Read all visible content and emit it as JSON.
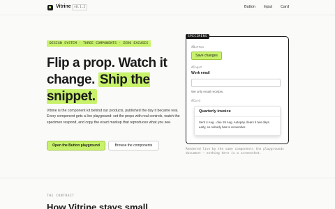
{
  "header": {
    "brand": "Vitrine",
    "version": "v0.1.2",
    "nav": [
      "Button",
      "Input",
      "Card"
    ]
  },
  "hero": {
    "tagline": "DESIGN SYSTEM · THREE COMPONENTS · ZERO EXCUSES",
    "headline_plain": "Flip a prop. Watch it change.",
    "headline_highlight": "Ship the snippet.",
    "description": "Vitrine is the component kit behind our products, published the day it became real. Every component gets a live playground: set the props with real controls, watch the specimen respond, and copy the exact markup that reproduces what you see.",
    "primary_cta": "Open the Button playground",
    "secondary_cta": "Browse the components"
  },
  "specimens": {
    "tag": "SPECIMENS",
    "button": {
      "label": "#Button",
      "text": "Save changes"
    },
    "input": {
      "label": "#Input",
      "field_label": "Work email",
      "hint": "We only email receipts."
    },
    "card": {
      "label": "#Card",
      "title": "Quarterly invoice",
      "body": "Sent 4 Aug · due 18 Aug. Autopay clears it two days early, so nobody has to remember."
    },
    "caption": "Rendered live by the same components the playgrounds document — nothing here is a screenshot."
  },
  "contract": {
    "label": "THE CONTRACT",
    "title": "How Vitrine stays small"
  },
  "colors": {
    "accent": "#c8f26b",
    "ink": "#1a1a1a",
    "background": "#fafaf8"
  }
}
